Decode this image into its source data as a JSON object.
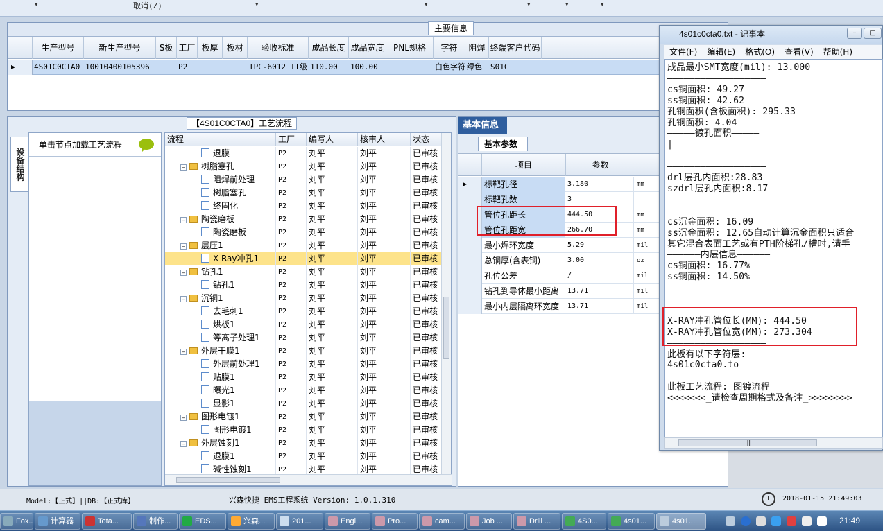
{
  "topbar": {
    "cancel_label": "取消(Z)"
  },
  "main_info": {
    "tab_label": "主要信息",
    "columns": [
      "生产型号",
      "新生产型号",
      "S板",
      "工厂",
      "板厚",
      "板材",
      "验收标准",
      "成品长度",
      "成品宽度",
      "PNL规格",
      "字符",
      "阻焊",
      "终端客户代码"
    ],
    "row": [
      "4S01C0CTA0",
      "10010400105396",
      "",
      "P2",
      "",
      "",
      "IPC-6012 II级",
      "110.00",
      "100.00",
      "",
      "白色字符",
      "绿色",
      "S01C"
    ]
  },
  "process": {
    "title": "【4S01C0CTA0】工艺流程",
    "side_tab": "设备结构",
    "hint": "单击节点加载工艺流程",
    "columns": [
      "流程",
      "工厂",
      "编写人",
      "核审人",
      "状态"
    ],
    "rows": [
      {
        "name": "退膜",
        "level": 2,
        "type": "file",
        "factory": "P2",
        "writer": "刘平",
        "reviewer": "刘平",
        "status": "已审核"
      },
      {
        "name": "树脂塞孔",
        "level": 1,
        "type": "folder",
        "factory": "P2",
        "writer": "刘平",
        "reviewer": "刘平",
        "status": "已审核"
      },
      {
        "name": "阻焊前处理",
        "level": 2,
        "type": "file",
        "factory": "P2",
        "writer": "刘平",
        "reviewer": "刘平",
        "status": "已审核"
      },
      {
        "name": "树脂塞孔",
        "level": 2,
        "type": "file",
        "factory": "P2",
        "writer": "刘平",
        "reviewer": "刘平",
        "status": "已审核"
      },
      {
        "name": "终固化",
        "level": 2,
        "type": "file",
        "factory": "P2",
        "writer": "刘平",
        "reviewer": "刘平",
        "status": "已审核"
      },
      {
        "name": "陶瓷磨板",
        "level": 1,
        "type": "folder",
        "factory": "P2",
        "writer": "刘平",
        "reviewer": "刘平",
        "status": "已审核"
      },
      {
        "name": "陶瓷磨板",
        "level": 2,
        "type": "file",
        "factory": "P2",
        "writer": "刘平",
        "reviewer": "刘平",
        "status": "已审核"
      },
      {
        "name": "层压1",
        "level": 1,
        "type": "folder",
        "factory": "P2",
        "writer": "刘平",
        "reviewer": "刘平",
        "status": "已审核"
      },
      {
        "name": "X-Ray冲孔1",
        "level": 2,
        "type": "file",
        "factory": "P2",
        "writer": "刘平",
        "reviewer": "刘平",
        "status": "已审核",
        "selected": true
      },
      {
        "name": "钻孔1",
        "level": 1,
        "type": "folder",
        "factory": "P2",
        "writer": "刘平",
        "reviewer": "刘平",
        "status": "已审核"
      },
      {
        "name": "钻孔1",
        "level": 2,
        "type": "file",
        "factory": "P2",
        "writer": "刘平",
        "reviewer": "刘平",
        "status": "已审核"
      },
      {
        "name": "沉铜1",
        "level": 1,
        "type": "folder",
        "factory": "P2",
        "writer": "刘平",
        "reviewer": "刘平",
        "status": "已审核"
      },
      {
        "name": "去毛刺1",
        "level": 2,
        "type": "file",
        "factory": "P2",
        "writer": "刘平",
        "reviewer": "刘平",
        "status": "已审核"
      },
      {
        "name": "烘板1",
        "level": 2,
        "type": "file",
        "factory": "P2",
        "writer": "刘平",
        "reviewer": "刘平",
        "status": "已审核"
      },
      {
        "name": "等离子处理1",
        "level": 2,
        "type": "file",
        "factory": "P2",
        "writer": "刘平",
        "reviewer": "刘平",
        "status": "已审核"
      },
      {
        "name": "外层干膜1",
        "level": 1,
        "type": "folder",
        "factory": "P2",
        "writer": "刘平",
        "reviewer": "刘平",
        "status": "已审核"
      },
      {
        "name": "外层前处理1",
        "level": 2,
        "type": "file",
        "factory": "P2",
        "writer": "刘平",
        "reviewer": "刘平",
        "status": "已审核"
      },
      {
        "name": "贴膜1",
        "level": 2,
        "type": "file",
        "factory": "P2",
        "writer": "刘平",
        "reviewer": "刘平",
        "status": "已审核"
      },
      {
        "name": "曝光1",
        "level": 2,
        "type": "file",
        "factory": "P2",
        "writer": "刘平",
        "reviewer": "刘平",
        "status": "已审核"
      },
      {
        "name": "显影1",
        "level": 2,
        "type": "file",
        "factory": "P2",
        "writer": "刘平",
        "reviewer": "刘平",
        "status": "已审核"
      },
      {
        "name": "图形电镀1",
        "level": 1,
        "type": "folder",
        "factory": "P2",
        "writer": "刘平",
        "reviewer": "刘平",
        "status": "已审核"
      },
      {
        "name": "图形电镀1",
        "level": 2,
        "type": "file",
        "factory": "P2",
        "writer": "刘平",
        "reviewer": "刘平",
        "status": "已审核"
      },
      {
        "name": "外层蚀刻1",
        "level": 1,
        "type": "folder",
        "factory": "P2",
        "writer": "刘平",
        "reviewer": "刘平",
        "status": "已审核"
      },
      {
        "name": "退膜1",
        "level": 2,
        "type": "file",
        "factory": "P2",
        "writer": "刘平",
        "reviewer": "刘平",
        "status": "已审核"
      },
      {
        "name": "碱性蚀刻1",
        "level": 2,
        "type": "file",
        "factory": "P2",
        "writer": "刘平",
        "reviewer": "刘平",
        "status": "已审核"
      }
    ]
  },
  "basic_info": {
    "tab_label": "基本信息",
    "subtab_label": "基本参数",
    "columns": [
      "项目",
      "参数"
    ],
    "rows": [
      {
        "item": "标靶孔径",
        "value": "3.180",
        "unit": "mm"
      },
      {
        "item": "标靶孔数",
        "value": "3",
        "unit": ""
      },
      {
        "item": "管位孔距长",
        "value": "444.50",
        "unit": "mm"
      },
      {
        "item": "管位孔距宽",
        "value": "266.70",
        "unit": "mm"
      },
      {
        "item": "最小焊环宽度",
        "value": "5.29",
        "unit": "mil"
      },
      {
        "item": "总铜厚(含表铜)",
        "value": "3.00",
        "unit": "oz"
      },
      {
        "item": "孔位公差",
        "value": "/",
        "unit": "mil"
      },
      {
        "item": "钻孔到导体最小距离",
        "value": "13.71",
        "unit": "mil"
      },
      {
        "item": "最小内层隔离环宽度",
        "value": "13.71",
        "unit": "mil"
      }
    ]
  },
  "notepad": {
    "title": "4s01c0cta0.txt - 记事本",
    "menu": [
      "文件(F)",
      "编辑(E)",
      "格式(O)",
      "查看(V)",
      "帮助(H)"
    ],
    "lines": [
      "成品最小SMT宽度(mil): 13.000",
      "——————————————————",
      "cs铜面积: 49.27",
      "ss铜面积: 42.62",
      "孔铜面积(含板面积): 295.33",
      "孔铜面积: 4.04",
      "—————镀孔面积—————",
      "|",
      "",
      "——————————————————",
      "drl层孔内面积:28.83",
      "szdrl层孔内面积:8.17",
      "",
      "——————————————————",
      "cs沉金面积: 16.09",
      "ss沉金面积: 12.65自动计算沉金面积只适合",
      "其它混合表面工艺或有PTH阶梯孔/槽时,请手",
      "——————内层信息——————",
      "cs铜面积: 16.77%",
      "ss铜面积: 14.50%",
      "",
      "——————————————————",
      "",
      "X-RAY冲孔管位长(MM): 444.50",
      "X-RAY冲孔管位宽(MM): 273.304",
      "——————————————————",
      "此板有以下字符层:",
      "4s01c0cta0.to",
      "——————————————————",
      "此板工艺流程: 图镀流程",
      "<<<<<<<_请检查周期格式及备注_>>>>>>>>"
    ]
  },
  "statusbar": {
    "model": "Model:【正式】||DB:【正式库】",
    "app": "兴森快捷 EMS工程系统 Version: 1.0.1.310",
    "datetime": "2018-01-15 21:49:03"
  },
  "taskbar": {
    "items": [
      "Fox...",
      "计算器",
      "Tota...",
      "制作...",
      "EDS...",
      "兴森...",
      "201...",
      "Engi...",
      "Pro...",
      "cam...",
      "Job ...",
      "Drill ...",
      "4S0...",
      "4s01...",
      "4s01..."
    ],
    "time": "21:49"
  }
}
